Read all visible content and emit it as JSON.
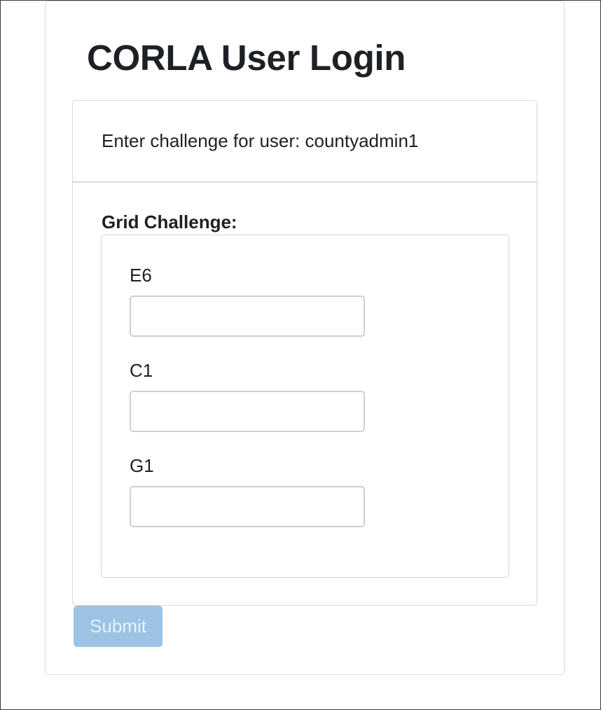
{
  "page": {
    "title": "CORLA User Login"
  },
  "user_panel": {
    "prompt": "Enter challenge for user: countyadmin1"
  },
  "challenge": {
    "heading": "Grid Challenge:",
    "fields": [
      {
        "label": "E6",
        "value": "",
        "placeholder": ""
      },
      {
        "label": "C1",
        "value": "",
        "placeholder": ""
      },
      {
        "label": "G1",
        "value": "",
        "placeholder": ""
      }
    ]
  },
  "actions": {
    "submit_label": "Submit",
    "submit_state": "disabled"
  },
  "colors": {
    "submit_bg": "#9cc3e3",
    "submit_text": "#e9f2fa",
    "border": "#d9d9d9",
    "text": "#1d2125"
  }
}
